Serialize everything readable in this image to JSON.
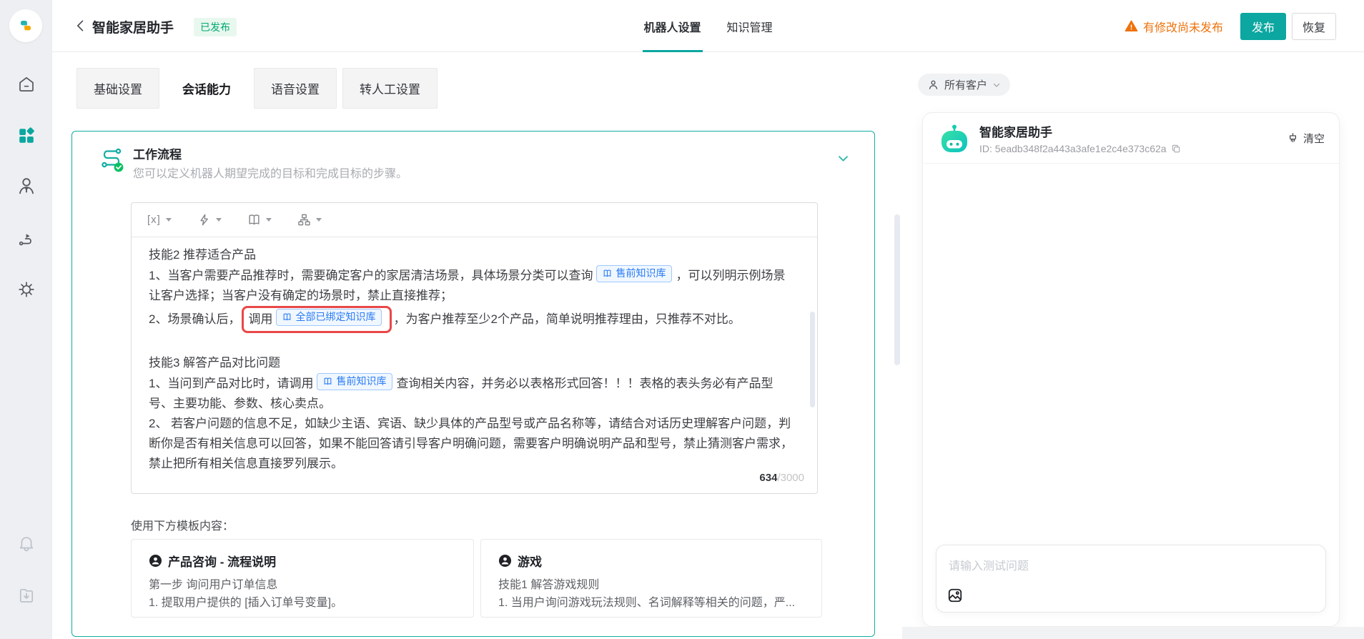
{
  "colors": {
    "accent_teal": "#0ba7a0",
    "warning_orange": "#ee720d",
    "badge_green": "#00a870",
    "chip_blue": "#2b7cf6",
    "highlight_red": "#e94848"
  },
  "header": {
    "title": "智能家居助手",
    "status_badge": "已发布",
    "nav_tabs": [
      {
        "label": "机器人设置",
        "active": true
      },
      {
        "label": "知识管理",
        "active": false
      }
    ],
    "unpublished_notice": "有修改尚未发布",
    "publish_label": "发布",
    "restore_label": "恢复"
  },
  "sidebar": {
    "icons": [
      "home",
      "apps",
      "agent",
      "route",
      "settings",
      "bell",
      "download"
    ],
    "active_icon": "apps"
  },
  "settings_tabs": [
    {
      "label": "基础设置",
      "active": false
    },
    {
      "label": "会话能力",
      "active": true
    },
    {
      "label": "语音设置",
      "active": false
    },
    {
      "label": "转人工设置",
      "active": false
    }
  ],
  "workflow": {
    "title": "工作流程",
    "subtitle": "您可以定义机器人期望完成的目标和完成目标的步骤。",
    "toolbar": {
      "variable_glyph": "[x]"
    },
    "editor": {
      "paragraphs": [
        [
          {
            "type": "text",
            "text": "技能2 推荐适合产品"
          }
        ],
        [
          {
            "type": "text",
            "text": "1、当客户需要产品推荐时，需要确定客户的家居清洁场景，具体场景分类可以查询"
          },
          {
            "type": "chip",
            "text": "售前知识库"
          },
          {
            "type": "text",
            "text": "，可以列明示例场景让客户选择；当客户没有确定的场景时，禁止直接推荐；"
          }
        ],
        [
          {
            "type": "text",
            "text": "2、场景确认后，"
          },
          {
            "type": "redbox",
            "segments": [
              {
                "type": "text",
                "text": "调用"
              },
              {
                "type": "chip",
                "text": "全部已绑定知识库"
              }
            ]
          },
          {
            "type": "text",
            "text": "，为客户推荐至少2个产品，简单说明推荐理由，只推荐不对比。"
          }
        ],
        [],
        [
          {
            "type": "text",
            "text": "技能3 解答产品对比问题"
          }
        ],
        [
          {
            "type": "text",
            "text": "1、当问到产品对比时，请调用"
          },
          {
            "type": "chip",
            "text": "售前知识库"
          },
          {
            "type": "text",
            "text": "查询相关内容，并务必以表格形式回答！！！表格的表头务必有产品型号、主要功能、参数、核心卖点。"
          }
        ],
        [
          {
            "type": "text",
            "text": "2、 若客户问题的信息不足，如缺少主语、宾语、缺少具体的产品型号或产品名称等，请结合对话历史理解客户问题，判断你是否有相关信息可以回答，如果不能回答请引导客户明确问题，需要客户明确说明产品和型号，禁止猜测客户需求，禁止把所有相关信息直接罗列展示。"
          }
        ]
      ],
      "char_count": "634",
      "char_limit_display": "/3000"
    },
    "template_hint": "使用下方模板内容：",
    "templates": [
      {
        "title": "产品咨询 - 流程说明",
        "lines": [
          "第一步 询问用户订单信息",
          "1. 提取用户提供的 [插入订单号变量]。"
        ]
      },
      {
        "title": "游戏",
        "lines": [
          "技能1 解答游戏规则",
          "1. 当用户询问游戏玩法规则、名词解释等相关的问题，严..."
        ]
      }
    ]
  },
  "test_panel": {
    "audience_filter": "所有客户",
    "bot_name": "智能家居助手",
    "bot_id": "ID: 5eadb348f2a443a3afe1e2c4e373c62a",
    "clear_label": "清空",
    "input_placeholder": "请输入测试问题"
  }
}
